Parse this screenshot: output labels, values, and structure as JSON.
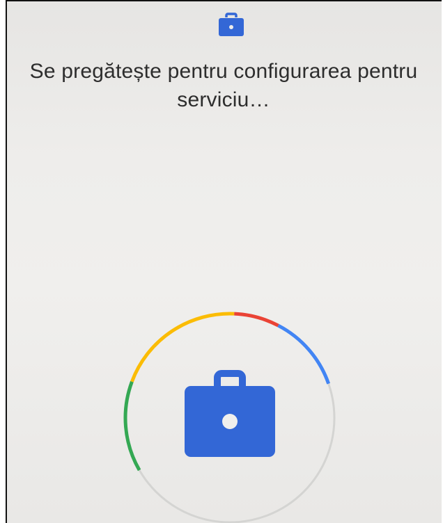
{
  "screen": {
    "title": "Se pregătește pentru configurarea pentru serviciu…"
  },
  "icons": {
    "header_icon": "briefcase-icon",
    "center_icon": "briefcase-icon"
  },
  "progress": {
    "fraction": 0.53,
    "segments": [
      {
        "color": "#34a853",
        "from": 0.0,
        "to": 0.14
      },
      {
        "color": "#fbbc05",
        "from": 0.14,
        "to": 0.34
      },
      {
        "color": "#ea4335",
        "from": 0.34,
        "to": 0.41
      },
      {
        "color": "#4285f4",
        "from": 0.41,
        "to": 0.53
      }
    ],
    "track_color": "#d4d4d2"
  },
  "colors": {
    "accent": "#3367d6",
    "text": "#2d2d2d"
  }
}
